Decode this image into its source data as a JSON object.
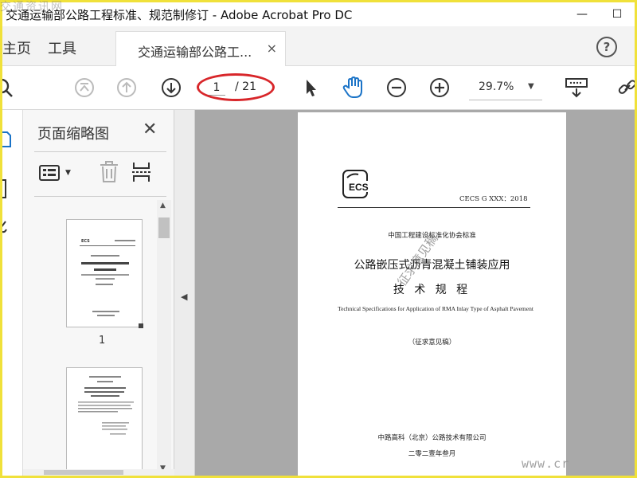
{
  "window": {
    "title": "交通运输部公路工程标准、规范制修订 - Adobe Acrobat Pro DC",
    "minimize": "—",
    "maximize": "☐"
  },
  "tabs": {
    "home": "主页",
    "tools": "工具",
    "doc_tab": "交通运输部公路工...",
    "doc_tab_close": "×",
    "help": "?"
  },
  "toolbar": {
    "page_current": "1",
    "page_total": "/ 21",
    "zoom": "29.7%",
    "highlight_color": "#d8262a",
    "hand_tool_color": "#1a73c7"
  },
  "thumbnails": {
    "title": "页面缩略图",
    "close": "✕",
    "page1_number": "1"
  },
  "document": {
    "logo_text": "ECS",
    "std_code": "CECS G XXX：2018",
    "association": "中国工程建设标准化协会标准",
    "title": "公路嵌压式沥青混凝土铺装应用",
    "subtitle": "技 术 规 程",
    "title_en": "Technical Specifications for Application of RMA Inlay Type of Asphalt Pavement",
    "draft": "（征求意见稿）",
    "stamp": "征求意见稿",
    "organization": "中路高科（北京）公路技术有限公司",
    "date": "二零二壹年叁月"
  },
  "watermark": {
    "top": "交通资讯网",
    "bottom": "www.cr"
  }
}
